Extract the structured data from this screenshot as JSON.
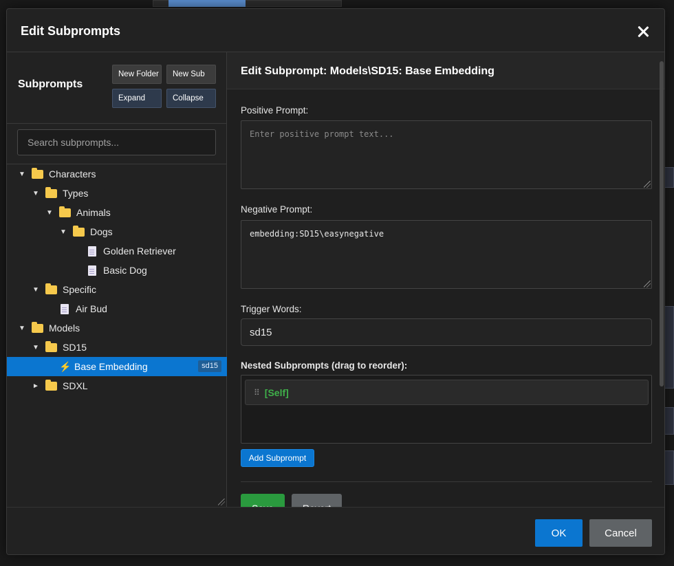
{
  "dialog": {
    "title": "Edit Subprompts"
  },
  "sidebar": {
    "title": "Subprompts",
    "buttons": {
      "new_folder": "New Folder",
      "new_sub": "New Sub",
      "expand": "Expand",
      "collapse": "Collapse"
    },
    "search_placeholder": "Search subprompts...",
    "tree": [
      {
        "label": "Characters",
        "type": "folder",
        "expanded": true
      },
      {
        "label": "Types",
        "type": "folder",
        "expanded": true
      },
      {
        "label": "Animals",
        "type": "folder",
        "expanded": true
      },
      {
        "label": "Dogs",
        "type": "folder",
        "expanded": true
      },
      {
        "label": "Golden Retriever",
        "type": "file"
      },
      {
        "label": "Basic Dog",
        "type": "file"
      },
      {
        "label": "Specific",
        "type": "folder",
        "expanded": true
      },
      {
        "label": "Air Bud",
        "type": "file"
      },
      {
        "label": "Models",
        "type": "folder",
        "expanded": true
      },
      {
        "label": "SD15",
        "type": "folder",
        "expanded": true
      },
      {
        "label": "Base Embedding",
        "type": "embedding",
        "selected": true,
        "tag": "sd15"
      },
      {
        "label": "SDXL",
        "type": "folder",
        "expanded": false
      }
    ]
  },
  "editor": {
    "title": "Edit Subprompt: Models\\SD15: Base Embedding",
    "positive_label": "Positive Prompt:",
    "positive_placeholder": "Enter positive prompt text...",
    "positive_value": "",
    "negative_label": "Negative Prompt:",
    "negative_value": "embedding:SD15\\easynegative",
    "trigger_label": "Trigger Words:",
    "trigger_value": "sd15",
    "nested_label": "Nested Subprompts (drag to reorder):",
    "nested_items": [
      "[Self]"
    ],
    "add_button": "Add Subprompt",
    "save_button": "Save",
    "revert_button": "Revert"
  },
  "footer": {
    "ok": "OK",
    "cancel": "Cancel"
  },
  "colors": {
    "accent": "#0b76d0",
    "save": "#2a9a3e",
    "folder": "#f6c94c",
    "self": "#3fb04a"
  }
}
